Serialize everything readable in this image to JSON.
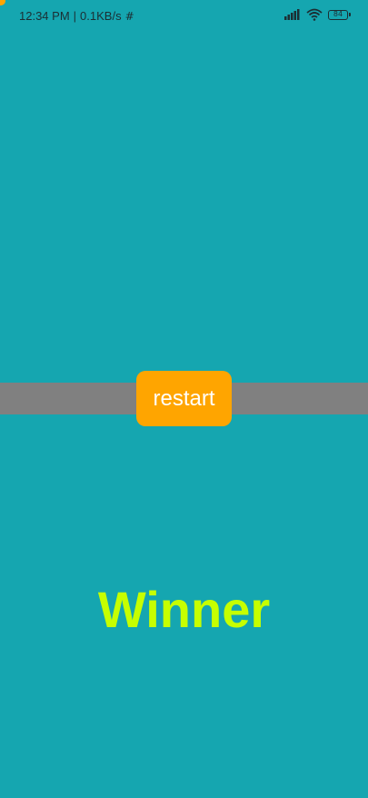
{
  "status_bar": {
    "time": "12:34 PM",
    "separator": "|",
    "network_speed": "0.1KB/s",
    "hash_icon": "#",
    "signal_icon": "cellular-signal-icon",
    "wifi_icon": "wifi-icon",
    "battery_level": "84"
  },
  "game": {
    "restart_label": "restart",
    "result_text": "Winner"
  },
  "colors": {
    "background": "#15a6b0",
    "band": "#808080",
    "button": "#ffa500",
    "winner": "#c6ff00"
  }
}
